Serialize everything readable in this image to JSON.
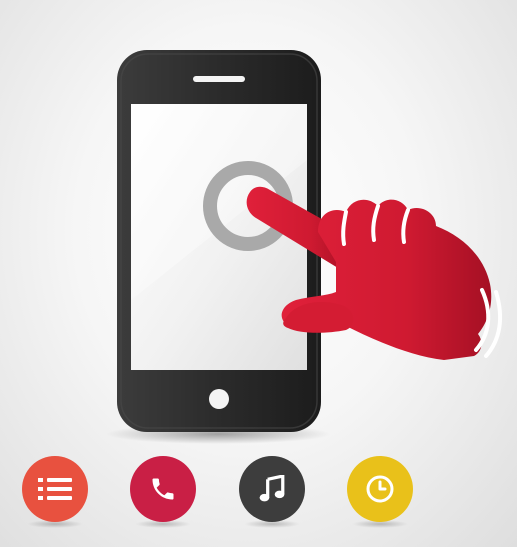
{
  "colors": {
    "background": "#f3f3f3",
    "phone_body": "#2e2e2e",
    "screen": "#ececec",
    "target_ring": "#a9a9a9",
    "hand": "#d01b2e",
    "menu_app": "#e8513f",
    "phone_app": "#c91f45",
    "music_app": "#3d3d3d",
    "clock_app": "#e9c11a"
  },
  "apps": [
    {
      "name": "menu-list",
      "icon": "list-icon",
      "color": "#e8513f"
    },
    {
      "name": "phone",
      "icon": "phone-icon",
      "color": "#c91f45"
    },
    {
      "name": "music",
      "icon": "music-note-icon",
      "color": "#3d3d3d"
    },
    {
      "name": "clock",
      "icon": "clock-icon",
      "color": "#e9c11a"
    }
  ]
}
